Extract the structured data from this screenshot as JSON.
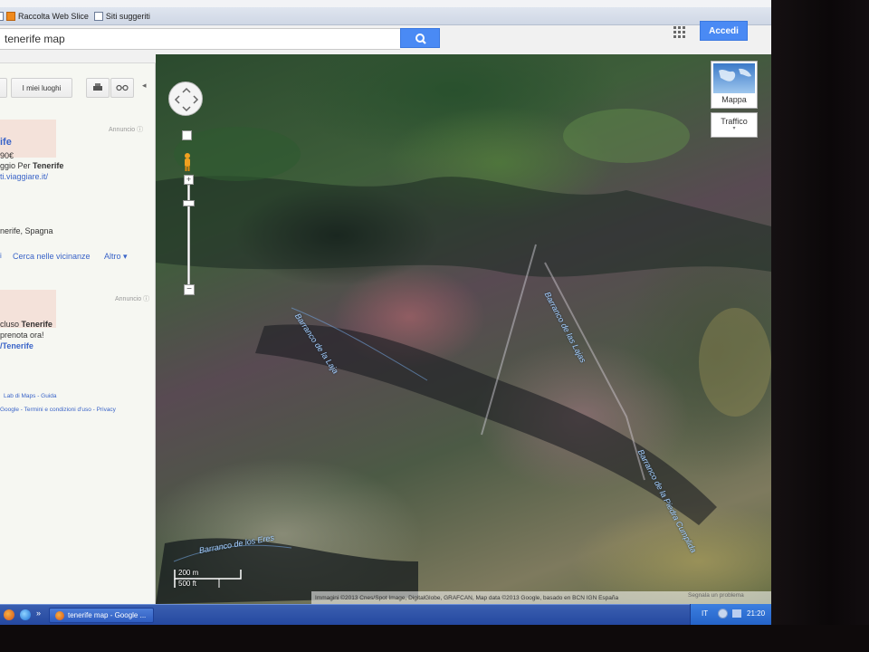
{
  "favorites_bar": {
    "items": [
      "Raccolta Web Slice",
      "Siti suggeriti"
    ]
  },
  "header": {
    "search_value": "tenerife map",
    "signin_label": "Accedi"
  },
  "left_panel": {
    "my_places_label": "I miei luoghi",
    "ad1": {
      "ads_label": "Annuncio",
      "title": "ife",
      "line1": "90€",
      "line2_prefix": "ggio Per ",
      "line2_bold": "Tenerife",
      "url": "ti.viaggiare.it/"
    },
    "place_line": "nerife, Spagna",
    "nearby_link": "Cerca nelle vicinanze",
    "more_link": "Altro",
    "ad2": {
      "ads_label": "Annuncio",
      "line1_prefix": "cluso ",
      "line1_bold": "Tenerife",
      "line2": "prenota ora!",
      "url": "/Tenerife"
    },
    "footer_links": "Lab di Maps - Guida",
    "footer_terms": "Google - Termini e condizioni d'uso - Privacy"
  },
  "map": {
    "map_type_label": "Mappa",
    "traffic_label": "Traffico",
    "labels": [
      "Barranco de la Laja",
      "Barranco de las Lajas",
      "Barranco de la Piedra Cumplida",
      "Barranco de los Eres"
    ],
    "scale_top": "200 m",
    "scale_bottom": "500 ft",
    "attribution": "Immagini ©2013 Cnes/Spot Image, DigitalGlobe, GRAFCAN, Map data ©2013 Google, basado en BCN IGN España",
    "report_link": "Segnala un problema"
  },
  "taskbar": {
    "task_label": "tenerife map - Google ...",
    "language": "IT",
    "clock": "21:20"
  },
  "colors": {
    "accent_blue": "#4a8af4",
    "taskbar_blue": "#2548a0"
  }
}
